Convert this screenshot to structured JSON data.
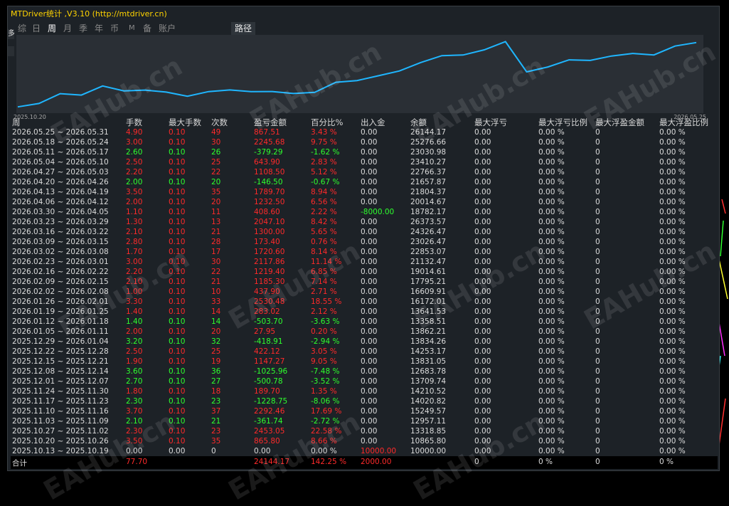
{
  "window": {
    "title": "MTDriver统计 ,V3.10 (http://mtdriver.cn)",
    "left_stub_label": "多"
  },
  "tabs": [
    "综",
    "日",
    "周",
    "月",
    "季",
    "年",
    "币",
    "M",
    "备",
    "账户"
  ],
  "active_tab": "周",
  "path_tab": "路径",
  "chart": {
    "start_label": "2025.10.20",
    "end_label": "2026.05.25",
    "line_color": "#1fb6ff"
  },
  "chart_data": {
    "type": "line",
    "x": [
      "2025.10.13",
      "2025.10.20",
      "2025.10.27",
      "2025.11.03",
      "2025.11.10",
      "2025.11.17",
      "2025.11.24",
      "2025.12.01",
      "2025.12.08",
      "2025.12.15",
      "2025.12.22",
      "2025.12.29",
      "2026.01.05",
      "2026.01.12",
      "2026.01.19",
      "2026.01.26",
      "2026.02.02",
      "2026.02.09",
      "2026.02.16",
      "2026.02.23",
      "2026.03.02",
      "2026.03.09",
      "2026.03.16",
      "2026.03.23",
      "2026.03.30",
      "2026.04.06",
      "2026.04.13",
      "2026.04.20",
      "2026.04.27",
      "2026.05.04",
      "2026.05.11",
      "2026.05.18",
      "2026.05.25"
    ],
    "series": [
      {
        "values": [
          10000.0,
          10865.8,
          13318.85,
          12957.11,
          15249.57,
          14020.82,
          14210.52,
          13709.74,
          12683.78,
          13831.05,
          14253.17,
          13834.26,
          13862.21,
          13358.51,
          13641.53,
          16172.01,
          16609.91,
          17795.21,
          19014.61,
          21132.47,
          22853.07,
          23026.47,
          24326.47,
          26373.57,
          18782.17,
          20014.67,
          21804.37,
          21657.87,
          22766.37,
          23410.27,
          23030.98,
          25276.66,
          26144.17
        ]
      }
    ]
  },
  "table": {
    "headers": [
      "周",
      "手数",
      "最大手数",
      "次数",
      "盈亏金额",
      "百分比%",
      "出入金",
      "余额",
      "最大浮亏",
      "最大浮亏比例",
      "最大浮盈金额",
      "最大浮盈比例"
    ],
    "rows": [
      {
        "s": "r",
        "v": [
          "2026.05.25 ~ 2026.05.31",
          "4.90",
          "0.10",
          "49",
          "867.51",
          "3.43 %",
          "0.00",
          "26144.17",
          "0.00",
          "0.00 %",
          "0",
          "0.00 %"
        ]
      },
      {
        "s": "r",
        "v": [
          "2026.05.18 ~ 2026.05.24",
          "3.00",
          "0.10",
          "30",
          "2245.68",
          "9.75 %",
          "0.00",
          "25276.66",
          "0.00",
          "0.00 %",
          "0",
          "0.00 %"
        ]
      },
      {
        "s": "g",
        "v": [
          "2026.05.11 ~ 2026.05.17",
          "2.60",
          "0.10",
          "26",
          "-379.29",
          "-1.62 %",
          "0.00",
          "23030.98",
          "0.00",
          "0.00 %",
          "0",
          "0.00 %"
        ]
      },
      {
        "s": "r",
        "v": [
          "2026.05.04 ~ 2026.05.10",
          "2.50",
          "0.10",
          "25",
          "643.90",
          "2.83 %",
          "0.00",
          "23410.27",
          "0.00",
          "0.00 %",
          "0",
          "0.00 %"
        ]
      },
      {
        "s": "r",
        "v": [
          "2026.04.27 ~ 2026.05.03",
          "2.20",
          "0.10",
          "22",
          "1108.50",
          "5.12 %",
          "0.00",
          "22766.37",
          "0.00",
          "0.00 %",
          "0",
          "0.00 %"
        ]
      },
      {
        "s": "g",
        "v": [
          "2026.04.20 ~ 2026.04.26",
          "2.00",
          "0.10",
          "20",
          "-146.50",
          "-0.67 %",
          "0.00",
          "21657.87",
          "0.00",
          "0.00 %",
          "0",
          "0.00 %"
        ]
      },
      {
        "s": "r",
        "v": [
          "2026.04.13 ~ 2026.04.19",
          "3.50",
          "0.10",
          "35",
          "1789.70",
          "8.94 %",
          "0.00",
          "21804.37",
          "0.00",
          "0.00 %",
          "0",
          "0.00 %"
        ]
      },
      {
        "s": "r",
        "v": [
          "2026.04.06 ~ 2026.04.12",
          "2.00",
          "0.10",
          "20",
          "1232.50",
          "6.56 %",
          "0.00",
          "20014.67",
          "0.00",
          "0.00 %",
          "0",
          "0.00 %"
        ]
      },
      {
        "s": "r",
        "v": [
          "2026.03.30 ~ 2026.04.05",
          "1.10",
          "0.10",
          "11",
          "408.60",
          "2.22 %",
          "-8000.00",
          "18782.17",
          "0.00",
          "0.00 %",
          "0",
          "0.00 %"
        ],
        "io": "g"
      },
      {
        "s": "r",
        "v": [
          "2026.03.23 ~ 2026.03.29",
          "1.30",
          "0.10",
          "13",
          "2047.10",
          "8.42 %",
          "0.00",
          "26373.57",
          "0.00",
          "0.00 %",
          "0",
          "0.00 %"
        ]
      },
      {
        "s": "r",
        "v": [
          "2026.03.16 ~ 2026.03.22",
          "2.10",
          "0.10",
          "21",
          "1300.00",
          "5.65 %",
          "0.00",
          "24326.47",
          "0.00",
          "0.00 %",
          "0",
          "0.00 %"
        ]
      },
      {
        "s": "r",
        "v": [
          "2026.03.09 ~ 2026.03.15",
          "2.80",
          "0.10",
          "28",
          "173.40",
          "0.76 %",
          "0.00",
          "23026.47",
          "0.00",
          "0.00 %",
          "0",
          "0.00 %"
        ]
      },
      {
        "s": "r",
        "v": [
          "2026.03.02 ~ 2026.03.08",
          "1.70",
          "0.10",
          "17",
          "1720.60",
          "8.14 %",
          "0.00",
          "22853.07",
          "0.00",
          "0.00 %",
          "0",
          "0.00 %"
        ]
      },
      {
        "s": "r",
        "v": [
          "2026.02.23 ~ 2026.03.01",
          "3.00",
          "0.10",
          "30",
          "2117.86",
          "11.14 %",
          "0.00",
          "21132.47",
          "0.00",
          "0.00 %",
          "0",
          "0.00 %"
        ]
      },
      {
        "s": "r",
        "v": [
          "2026.02.16 ~ 2026.02.22",
          "2.20",
          "0.10",
          "22",
          "1219.40",
          "6.85 %",
          "0.00",
          "19014.61",
          "0.00",
          "0.00 %",
          "0",
          "0.00 %"
        ]
      },
      {
        "s": "r",
        "v": [
          "2026.02.09 ~ 2026.02.15",
          "2.10",
          "0.10",
          "21",
          "1185.30",
          "7.14 %",
          "0.00",
          "17795.21",
          "0.00",
          "0.00 %",
          "0",
          "0.00 %"
        ]
      },
      {
        "s": "r",
        "v": [
          "2026.02.02 ~ 2026.02.08",
          "1.00",
          "0.10",
          "10",
          "437.90",
          "2.71 %",
          "0.00",
          "16609.91",
          "0.00",
          "0.00 %",
          "0",
          "0.00 %"
        ]
      },
      {
        "s": "r",
        "v": [
          "2026.01.26 ~ 2026.02.01",
          "3.30",
          "0.10",
          "33",
          "2530.48",
          "18.55 %",
          "0.00",
          "16172.01",
          "0.00",
          "0.00 %",
          "0",
          "0.00 %"
        ]
      },
      {
        "s": "r",
        "v": [
          "2026.01.19 ~ 2026.01.25",
          "1.40",
          "0.10",
          "14",
          "283.02",
          "2.12 %",
          "0.00",
          "13641.53",
          "0.00",
          "0.00 %",
          "0",
          "0.00 %"
        ]
      },
      {
        "s": "g",
        "v": [
          "2026.01.12 ~ 2026.01.18",
          "1.40",
          "0.10",
          "14",
          "-503.70",
          "-3.63 %",
          "0.00",
          "13358.51",
          "0.00",
          "0.00 %",
          "0",
          "0.00 %"
        ]
      },
      {
        "s": "r",
        "v": [
          "2026.01.05 ~ 2026.01.11",
          "2.00",
          "0.10",
          "20",
          "27.95",
          "0.20 %",
          "0.00",
          "13862.21",
          "0.00",
          "0.00 %",
          "0",
          "0.00 %"
        ]
      },
      {
        "s": "g",
        "v": [
          "2025.12.29 ~ 2026.01.04",
          "3.20",
          "0.10",
          "32",
          "-418.91",
          "-2.94 %",
          "0.00",
          "13834.26",
          "0.00",
          "0.00 %",
          "0",
          "0.00 %"
        ]
      },
      {
        "s": "r",
        "v": [
          "2025.12.22 ~ 2025.12.28",
          "2.50",
          "0.10",
          "25",
          "422.12",
          "3.05 %",
          "0.00",
          "14253.17",
          "0.00",
          "0.00 %",
          "0",
          "0.00 %"
        ]
      },
      {
        "s": "r",
        "v": [
          "2025.12.15 ~ 2025.12.21",
          "1.90",
          "0.10",
          "19",
          "1147.27",
          "9.05 %",
          "0.00",
          "13831.05",
          "0.00",
          "0.00 %",
          "0",
          "0.00 %"
        ]
      },
      {
        "s": "g",
        "v": [
          "2025.12.08 ~ 2025.12.14",
          "3.60",
          "0.10",
          "36",
          "-1025.96",
          "-7.48 %",
          "0.00",
          "12683.78",
          "0.00",
          "0.00 %",
          "0",
          "0.00 %"
        ]
      },
      {
        "s": "g",
        "v": [
          "2025.12.01 ~ 2025.12.07",
          "2.70",
          "0.10",
          "27",
          "-500.78",
          "-3.52 %",
          "0.00",
          "13709.74",
          "0.00",
          "0.00 %",
          "0",
          "0.00 %"
        ]
      },
      {
        "s": "r",
        "v": [
          "2025.11.24 ~ 2025.11.30",
          "1.80",
          "0.10",
          "18",
          "189.70",
          "1.35 %",
          "0.00",
          "14210.52",
          "0.00",
          "0.00 %",
          "0",
          "0.00 %"
        ]
      },
      {
        "s": "g",
        "v": [
          "2025.11.17 ~ 2025.11.23",
          "2.30",
          "0.10",
          "23",
          "-1228.75",
          "-8.06 %",
          "0.00",
          "14020.82",
          "0.00",
          "0.00 %",
          "0",
          "0.00 %"
        ]
      },
      {
        "s": "r",
        "v": [
          "2025.11.10 ~ 2025.11.16",
          "3.70",
          "0.10",
          "37",
          "2292.46",
          "17.69 %",
          "0.00",
          "15249.57",
          "0.00",
          "0.00 %",
          "0",
          "0.00 %"
        ]
      },
      {
        "s": "g",
        "v": [
          "2025.11.03 ~ 2025.11.09",
          "2.10",
          "0.10",
          "21",
          "-361.74",
          "-2.72 %",
          "0.00",
          "12957.11",
          "0.00",
          "0.00 %",
          "0",
          "0.00 %"
        ]
      },
      {
        "s": "r",
        "v": [
          "2025.10.27 ~ 2025.11.02",
          "2.30",
          "0.10",
          "23",
          "2453.05",
          "22.58 %",
          "0.00",
          "13318.85",
          "0.00",
          "0.00 %",
          "0",
          "0.00 %"
        ]
      },
      {
        "s": "r",
        "v": [
          "2025.10.20 ~ 2025.10.26",
          "3.50",
          "0.10",
          "35",
          "865.80",
          "8.66 %",
          "0.00",
          "10865.80",
          "0.00",
          "0.00 %",
          "0",
          "0.00 %"
        ]
      },
      {
        "s": "w",
        "v": [
          "2025.10.13 ~ 2025.10.19",
          "0.00",
          "0.00",
          "0",
          "0.00",
          "0.00 %",
          "10000.00",
          "10000.00",
          "0.00",
          "0.00 %",
          "0",
          "0.00 %"
        ],
        "io": "r"
      }
    ],
    "total": {
      "label": "合计",
      "lots": "77.70",
      "profit": "24144.17",
      "pct": "142.25 %",
      "io": "2000.00",
      "v8": "0",
      "v9": "0 %",
      "v10": "0",
      "v11": "0 %"
    }
  },
  "watermark": "EAHub.cn",
  "colors": {
    "profit": "#ff2a2a",
    "loss": "#2eff2e",
    "panel_bg": "#1d2227",
    "chart_bg": "#2a2f35"
  }
}
